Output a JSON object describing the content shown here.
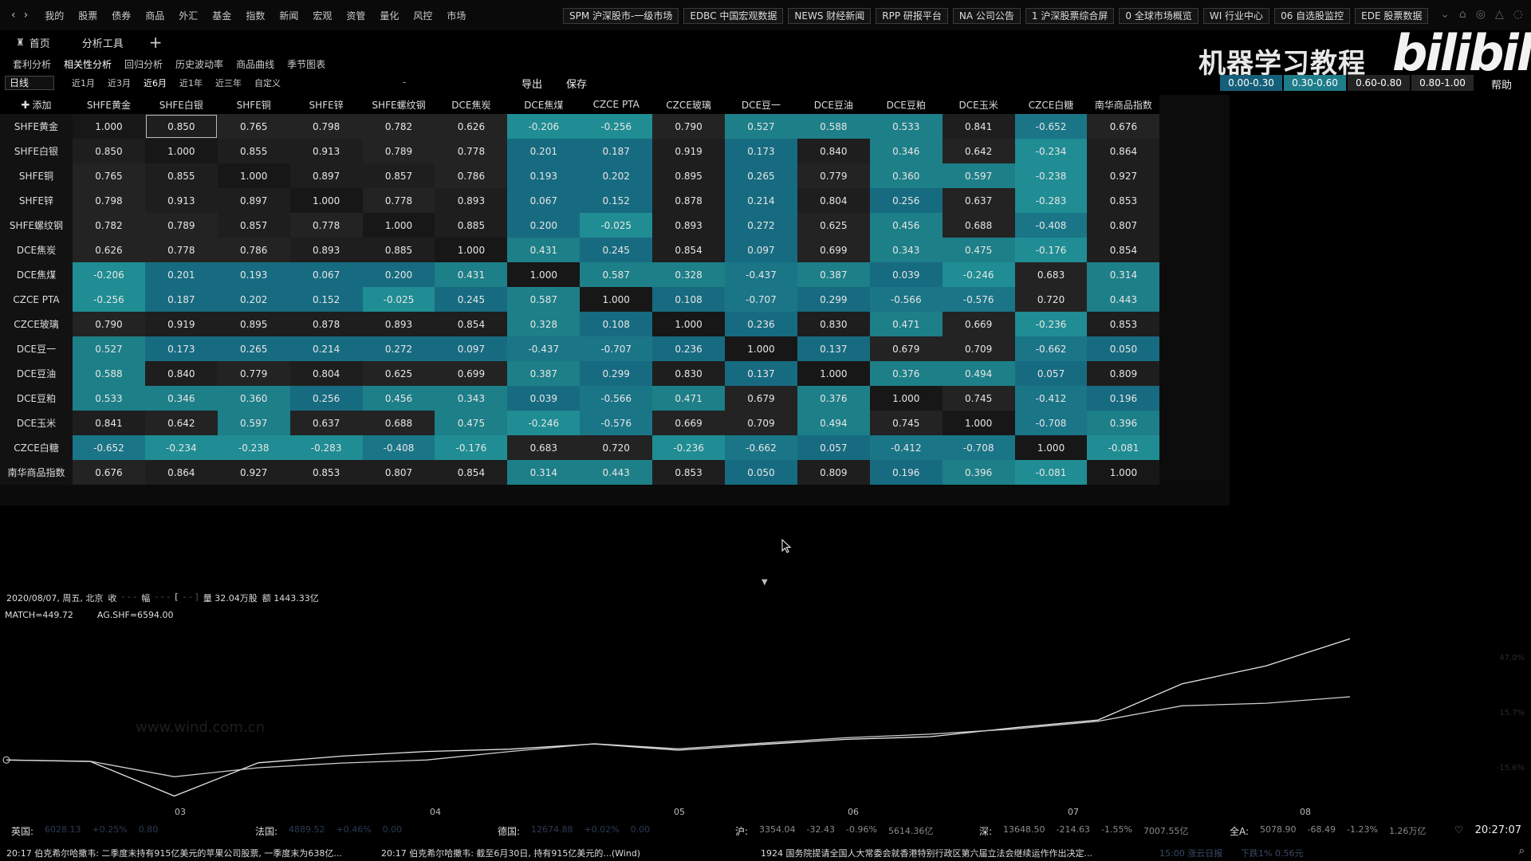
{
  "nav": {
    "back": "‹",
    "forward": "›"
  },
  "menu": [
    "我的",
    "股票",
    "债券",
    "商品",
    "外汇",
    "基金",
    "指数",
    "新闻",
    "宏观",
    "资管",
    "量化",
    "风控",
    "市场"
  ],
  "quicklinks": [
    "SPM 沪深股市-一级市场",
    "EDBC 中国宏观数据",
    "NEWS 财经新闻",
    "RPP 研报平台",
    "NA 公司公告",
    "1 沪深股票综合屏",
    "0 全球市场概览",
    "WI 行业中心",
    "06 自选股监控",
    "EDE 股票数据"
  ],
  "tabs": [
    {
      "icon": "♜",
      "label": "首页"
    },
    {
      "icon": "",
      "label": "分析工具"
    }
  ],
  "add_tab": "+",
  "watermark": {
    "text": "机器学习教程",
    "logo": "bilibili"
  },
  "subnav": {
    "items": [
      "套利分析",
      "相关性分析",
      "回归分析",
      "历史波动率",
      "商品曲线",
      "季节图表"
    ],
    "active": 1
  },
  "controls": {
    "period": "日线",
    "ranges": [
      "近1月",
      "近3月",
      "近6月",
      "近1年",
      "近三年",
      "自定义"
    ],
    "active_range": 2,
    "dash": "-",
    "export": "导出",
    "save": "保存",
    "help": "帮助"
  },
  "legend": [
    {
      "label": "0.00-0.30",
      "color": "#165f7a"
    },
    {
      "label": "0.30-0.60",
      "color": "#1f7d8a"
    },
    {
      "label": "0.60-0.80",
      "color": "#222222"
    },
    {
      "label": "0.80-1.00",
      "color": "#262626"
    }
  ],
  "matrix": {
    "add_label": "添加",
    "col_hint": "",
    "row_hint": "",
    "selected": [
      0,
      1
    ],
    "names": [
      "SHFE黄金",
      "SHFE白银",
      "SHFE铜",
      "SHFE锌",
      "SHFE螺纹钢",
      "DCE焦炭",
      "DCE焦煤",
      "CZCE PTA",
      "CZCE玻璃",
      "DCE豆一",
      "DCE豆油",
      "DCE豆粕",
      "DCE玉米",
      "CZCE白糖",
      "南华商品指数"
    ],
    "rows": [
      [
        "1.000",
        "0.850",
        "0.765",
        "0.798",
        "0.782",
        "0.626",
        "-0.206",
        "-0.256",
        "0.790",
        "0.527",
        "0.588",
        "0.533",
        "0.841",
        "-0.652",
        "0.676"
      ],
      [
        "0.850",
        "1.000",
        "0.855",
        "0.913",
        "0.789",
        "0.778",
        "0.201",
        "0.187",
        "0.919",
        "0.173",
        "0.840",
        "0.346",
        "0.642",
        "-0.234",
        "0.864"
      ],
      [
        "0.765",
        "0.855",
        "1.000",
        "0.897",
        "0.857",
        "0.786",
        "0.193",
        "0.202",
        "0.895",
        "0.265",
        "0.779",
        "0.360",
        "0.597",
        "-0.238",
        "0.927"
      ],
      [
        "0.798",
        "0.913",
        "0.897",
        "1.000",
        "0.778",
        "0.893",
        "0.067",
        "0.152",
        "0.878",
        "0.214",
        "0.804",
        "0.256",
        "0.637",
        "-0.283",
        "0.853"
      ],
      [
        "0.782",
        "0.789",
        "0.857",
        "0.778",
        "1.000",
        "0.885",
        "0.200",
        "-0.025",
        "0.893",
        "0.272",
        "0.625",
        "0.456",
        "0.688",
        "-0.408",
        "0.807"
      ],
      [
        "0.626",
        "0.778",
        "0.786",
        "0.893",
        "0.885",
        "1.000",
        "0.431",
        "0.245",
        "0.854",
        "0.097",
        "0.699",
        "0.343",
        "0.475",
        "-0.176",
        "0.854"
      ],
      [
        "-0.206",
        "0.201",
        "0.193",
        "0.067",
        "0.200",
        "0.431",
        "1.000",
        "0.587",
        "0.328",
        "-0.437",
        "0.387",
        "0.039",
        "-0.246",
        "0.683",
        "0.314"
      ],
      [
        "-0.256",
        "0.187",
        "0.202",
        "0.152",
        "-0.025",
        "0.245",
        "0.587",
        "1.000",
        "0.108",
        "-0.707",
        "0.299",
        "-0.566",
        "-0.576",
        "0.720",
        "0.443"
      ],
      [
        "0.790",
        "0.919",
        "0.895",
        "0.878",
        "0.893",
        "0.854",
        "0.328",
        "0.108",
        "1.000",
        "0.236",
        "0.830",
        "0.471",
        "0.669",
        "-0.236",
        "0.853"
      ],
      [
        "0.527",
        "0.173",
        "0.265",
        "0.214",
        "0.272",
        "0.097",
        "-0.437",
        "-0.707",
        "0.236",
        "1.000",
        "0.137",
        "0.679",
        "0.709",
        "-0.662",
        "0.050"
      ],
      [
        "0.588",
        "0.840",
        "0.779",
        "0.804",
        "0.625",
        "0.699",
        "0.387",
        "0.299",
        "0.830",
        "0.137",
        "1.000",
        "0.376",
        "0.494",
        "0.057",
        "0.809"
      ],
      [
        "0.533",
        "0.346",
        "0.360",
        "0.256",
        "0.456",
        "0.343",
        "0.039",
        "-0.566",
        "0.471",
        "0.679",
        "0.376",
        "1.000",
        "0.745",
        "-0.412",
        "0.196"
      ],
      [
        "0.841",
        "0.642",
        "0.597",
        "0.637",
        "0.688",
        "0.475",
        "-0.246",
        "-0.576",
        "0.669",
        "0.709",
        "0.494",
        "0.745",
        "1.000",
        "-0.708",
        "0.396"
      ],
      [
        "-0.652",
        "-0.234",
        "-0.238",
        "-0.283",
        "-0.408",
        "-0.176",
        "0.683",
        "0.720",
        "-0.236",
        "-0.662",
        "0.057",
        "-0.412",
        "-0.708",
        "1.000",
        "-0.081"
      ],
      [
        "0.676",
        "0.864",
        "0.927",
        "0.853",
        "0.807",
        "0.854",
        "0.314",
        "0.443",
        "0.853",
        "0.050",
        "0.809",
        "0.196",
        "0.396",
        "-0.081",
        "1.000"
      ]
    ]
  },
  "chart": {
    "collapse": "▼",
    "info": {
      "date": "2020/08/07, 周五, 北京",
      "close_label": "收",
      "amp_label": "幅",
      "bracket": "[",
      "vol": "量 32.04万股",
      "amt": "额 1443.33亿"
    },
    "series_labels": [
      "MATCH=449.72",
      "AG.SHF=6594.00"
    ],
    "x_ticks": [
      "03",
      "04",
      "05",
      "06",
      "07",
      "08"
    ],
    "right_ticks": [
      "47.0%",
      "15.7%",
      "-15.6%"
    ],
    "watermark_url": "www.wind.com.cn"
  },
  "chart_data": {
    "type": "line",
    "x": [
      "03",
      "04",
      "05",
      "06",
      "07",
      "08"
    ],
    "series": [
      {
        "name": "MATCH",
        "values": [
          0,
          -0.6,
          -14.0,
          -1.1,
          1.5,
          3.3,
          4.2,
          6.2,
          3.8,
          6.0,
          8.0,
          9.0,
          12.5,
          15.5,
          29.5,
          36.5,
          47.0
        ]
      },
      {
        "name": "AG.SHF",
        "values": [
          0,
          -0.5,
          -6.5,
          -3.0,
          -1.2,
          0.0,
          3.3,
          6.3,
          4.3,
          6.5,
          8.6,
          10.0,
          12.0,
          15.0,
          21.0,
          22.0,
          24.5
        ]
      }
    ],
    "ylabel": "",
    "xlabel": ""
  },
  "statusbar": {
    "markets": [
      {
        "label": "英国:",
        "values": [
          "6028.13",
          "+0.25%",
          "0.80"
        ]
      },
      {
        "label": "法国:",
        "values": [
          "4889.52",
          "+0.46%",
          "0.00"
        ]
      },
      {
        "label": "德国:",
        "values": [
          "12674.88",
          "+0.02%",
          "0.00"
        ]
      },
      {
        "label": "沪:",
        "values": [
          "3354.04",
          "-32.43",
          "-0.96%",
          "5614.36亿"
        ]
      },
      {
        "label": "深:",
        "values": [
          "13648.50",
          "-214.63",
          "-1.55%",
          "7007.55亿"
        ]
      },
      {
        "label": "全A:",
        "values": [
          "5078.90",
          "-68.49",
          "-1.23%",
          "1.26万亿"
        ]
      }
    ],
    "clock": "20:27:07",
    "heart": "♡"
  },
  "ticker": [
    "20:17 伯克希尔哈撒韦: 二季度末持有915亿美元的苹果公司股票, 一季度末为638亿...",
    "20:17 伯克希尔哈撒韦: 截至6月30日, 持有915亿美元的...(Wind)",
    "1924 国务院提请全国人大常委会就香港特别行政区第六届立法会继续运作作出决定...",
    "15:00 涨云日报",
    "下跌1% 0.56元"
  ],
  "colors": {
    "low": "#17657d",
    "mid": "#1f8a8f",
    "high": "#202020",
    "top": "#141414",
    "neg": "#2a8f95"
  }
}
